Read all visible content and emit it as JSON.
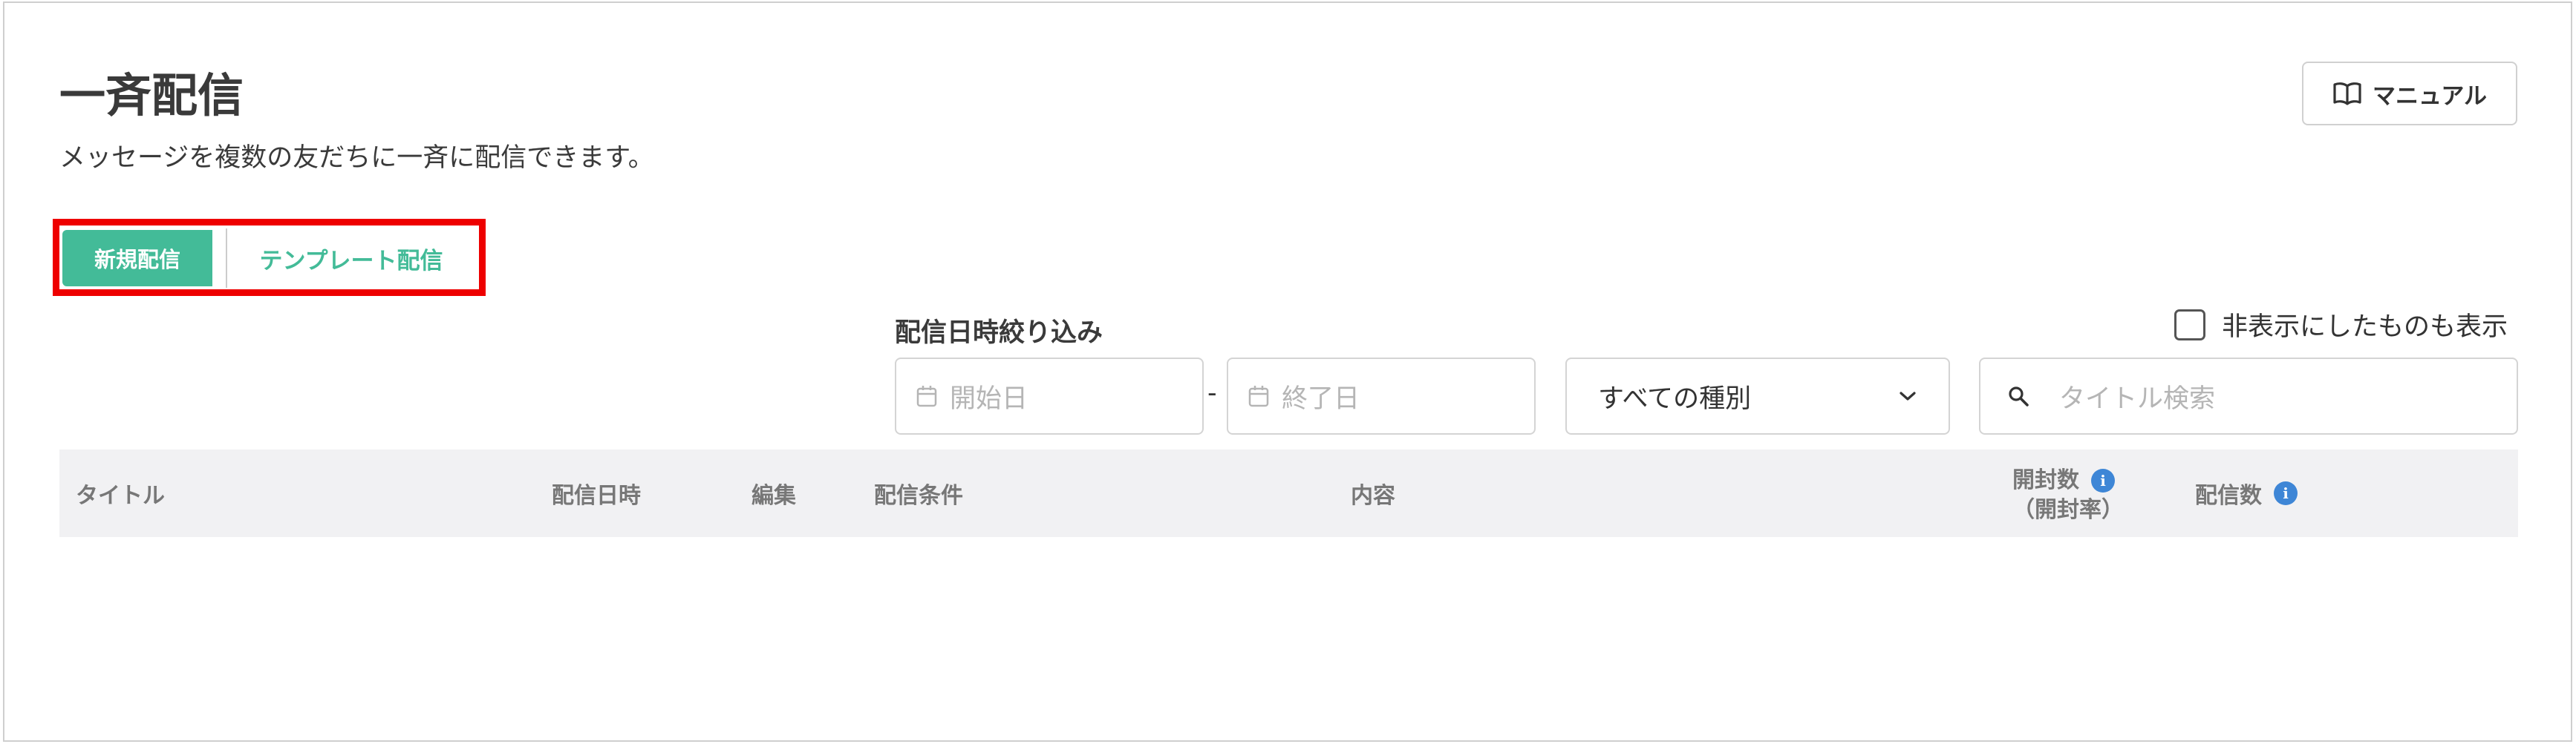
{
  "header": {
    "title": "一斉配信",
    "description": "メッセージを複数の友だちに一斉に配信できます。",
    "manual_label": "マニュアル"
  },
  "actions": {
    "new_label": "新規配信",
    "template_label": "テンプレート配信"
  },
  "filters": {
    "date_filter_label": "配信日時絞り込み",
    "start_placeholder": "開始日",
    "separator": "-",
    "end_placeholder": "終了日",
    "type_selected": "すべての種別",
    "search_placeholder": "タイトル検索",
    "show_hidden_label": "非表示にしたものも表示",
    "show_hidden_checked": false
  },
  "table": {
    "columns": {
      "title": "タイトル",
      "sent_at": "配信日時",
      "edit": "編集",
      "conditions": "配信条件",
      "content": "内容",
      "opens": "開封数",
      "open_rate": "（開封率）",
      "sent_count": "配信数"
    },
    "info_glyph": "i",
    "rows": []
  },
  "colors": {
    "primary": "#43bb98",
    "info": "#3e86d6",
    "highlight": "#ee0000",
    "header_bg": "#f1f1f3"
  },
  "icons": [
    "book-icon",
    "calendar-icon",
    "chevron-down-icon",
    "search-icon",
    "info-icon"
  ]
}
